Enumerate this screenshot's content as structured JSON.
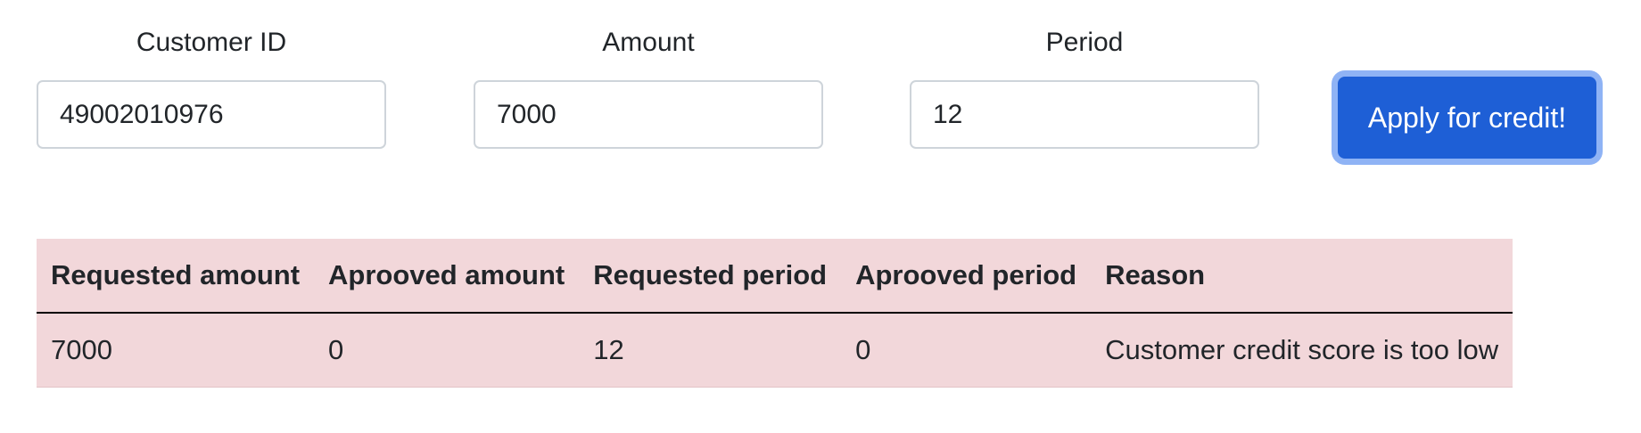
{
  "form": {
    "customer_id": {
      "label": "Customer ID",
      "value": "49002010976"
    },
    "amount": {
      "label": "Amount",
      "value": "7000"
    },
    "period": {
      "label": "Period",
      "value": "12"
    },
    "apply_label": "Apply for credit!"
  },
  "table": {
    "headers": [
      "Requested amount",
      "Aprooved amount",
      "Requested period",
      "Aprooved period",
      "Reason"
    ],
    "rows": [
      [
        "7000",
        "0",
        "12",
        "0",
        "Customer credit score is too low"
      ]
    ]
  },
  "colors": {
    "primary_button": "#1e5fd6",
    "button_focus_ring": "#8fb3f5",
    "table_background": "#f2d7da"
  }
}
